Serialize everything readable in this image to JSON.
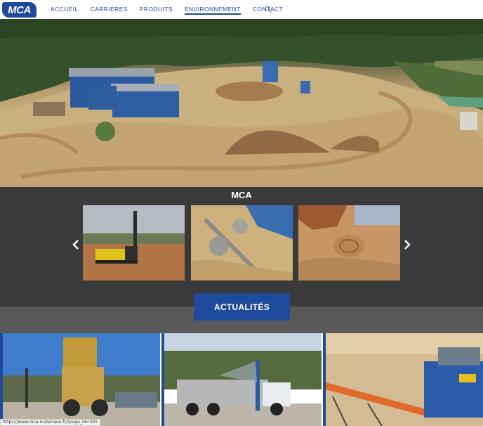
{
  "logo": {
    "text": "MCA"
  },
  "nav": {
    "items": [
      {
        "label": "ACCUEIL"
      },
      {
        "label": "CARRIÈRES"
      },
      {
        "label": "PRODUITS"
      },
      {
        "label": "ENVIRONNEMENT"
      },
      {
        "label": "CONTACT"
      }
    ],
    "active_index": 3,
    "search_icon": "search-icon"
  },
  "carousel": {
    "title": "MCA",
    "prev_icon": "chevron-left-icon",
    "next_icon": "chevron-right-icon"
  },
  "news": {
    "button_label": "ACTUALITÉS"
  },
  "status_bar": {
    "url": "https://www.mca-materiaux.fr/?page_id=335"
  },
  "colors": {
    "brand_blue": "#1f4a9c",
    "dark_band": "#3a3a3a",
    "gray_band": "#595959"
  }
}
